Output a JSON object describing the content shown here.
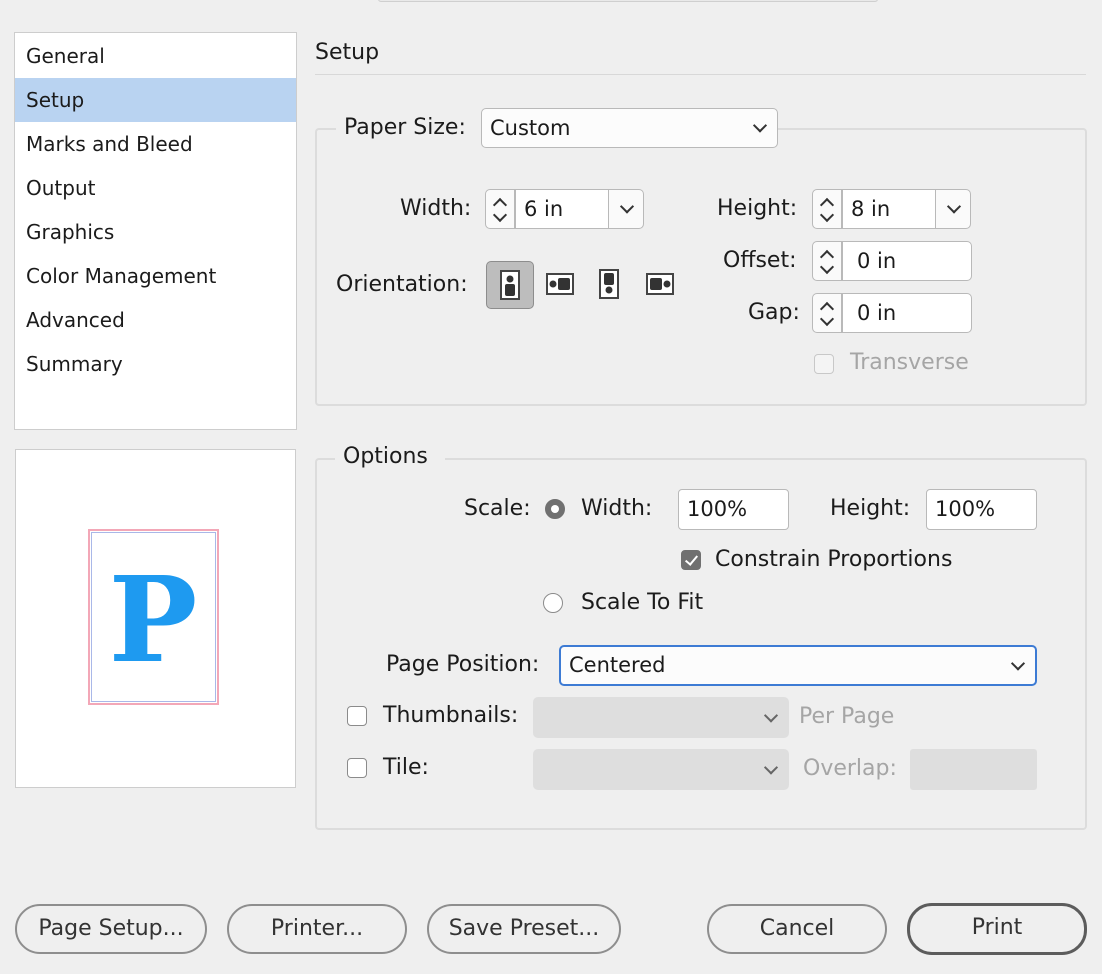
{
  "sidebar": {
    "items": [
      {
        "label": "General"
      },
      {
        "label": "Setup",
        "selected": true
      },
      {
        "label": "Marks and Bleed"
      },
      {
        "label": "Output"
      },
      {
        "label": "Graphics"
      },
      {
        "label": "Color Management"
      },
      {
        "label": "Advanced"
      },
      {
        "label": "Summary"
      }
    ]
  },
  "preview": {
    "glyph": "P",
    "glyph_color": "#1e9af0"
  },
  "setup": {
    "title": "Setup",
    "paper_size_label": "Paper Size:",
    "paper_size_value": "Custom",
    "width_label": "Width:",
    "width_value": "6 in",
    "height_label": "Height:",
    "height_value": "8 in",
    "offset_label": "Offset:",
    "offset_value": "0 in",
    "gap_label": "Gap:",
    "gap_value": "0 in",
    "orientation_label": "Orientation:",
    "orientation_icons": [
      "portrait-icon",
      "landscape-icon",
      "reverse-portrait-icon",
      "reverse-landscape-icon"
    ],
    "transverse_label": "Transverse"
  },
  "options": {
    "title": "Options",
    "scale_label": "Scale:",
    "scale_width_label": "Width:",
    "scale_width_value": "100%",
    "scale_height_label": "Height:",
    "scale_height_value": "100%",
    "constrain_label": "Constrain Proportions",
    "scale_to_fit_label": "Scale To Fit",
    "page_position_label": "Page Position:",
    "page_position_value": "Centered",
    "thumbnails_label": "Thumbnails:",
    "per_page_label": "Per Page",
    "tile_label": "Tile:",
    "overlap_label": "Overlap:"
  },
  "buttons": {
    "page_setup": "Page Setup...",
    "printer": "Printer...",
    "save_preset": "Save Preset...",
    "cancel": "Cancel",
    "print": "Print"
  }
}
